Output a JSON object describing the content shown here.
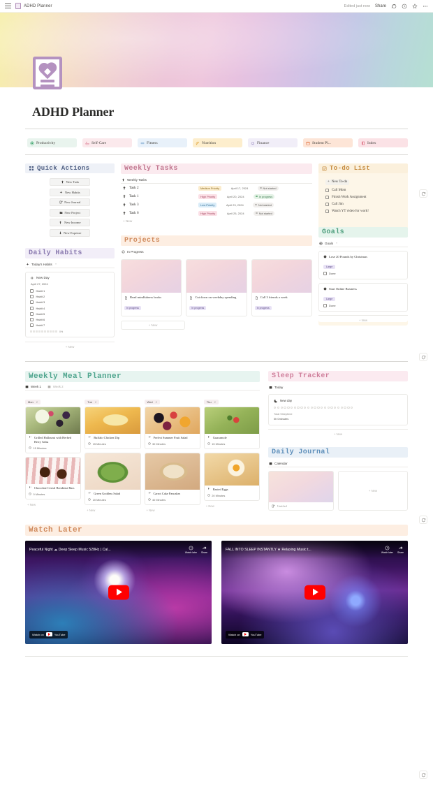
{
  "topbar": {
    "breadcrumb_title": "ADHD Planner",
    "edited_label": "Edited just now",
    "share_label": "Share",
    "icons": [
      "menu-icon",
      "comment-icon",
      "clock-icon",
      "star-icon",
      "more-icon"
    ]
  },
  "page": {
    "title": "ADHD Planner",
    "icon": "heart-document-icon"
  },
  "nav": {
    "items": [
      {
        "label": "Productivity",
        "icon": "target-icon",
        "bg": "#e9f4ee",
        "icon_color": "#3fa56f"
      },
      {
        "label": "Self-Care",
        "icon": "bath-icon",
        "bg": "#fbe9ec",
        "icon_color": "#d9748c"
      },
      {
        "label": "Fitness",
        "icon": "dumbbell-icon",
        "bg": "#e8f1fa",
        "icon_color": "#5e92c4"
      },
      {
        "label": "Nutrition",
        "icon": "carrot-icon",
        "bg": "#fdeecd",
        "icon_color": "#e0a238"
      },
      {
        "label": "Finance",
        "icon": "piggybank-icon",
        "bg": "#f1eef8",
        "icon_color": "#8878b7"
      },
      {
        "label": "Student Pl...",
        "icon": "calendar-icon",
        "bg": "#fde5d7",
        "icon_color": "#e0713f"
      },
      {
        "label": "Index",
        "icon": "book-icon",
        "bg": "#fbe2e6",
        "icon_color": "#d8566d"
      }
    ]
  },
  "quick_actions": {
    "title": "Quick Actions",
    "title_icon": "grid-icon",
    "buttons": [
      {
        "label": "New Task",
        "icon": "pin-icon"
      },
      {
        "label": "New Habits",
        "icon": "sparkle-icon"
      },
      {
        "label": "New Journal",
        "icon": "pencil-square-icon"
      },
      {
        "label": "New Project",
        "icon": "folder-icon"
      },
      {
        "label": "New Income",
        "icon": "arrow-up-icon"
      },
      {
        "label": "New Expense",
        "icon": "arrow-down-icon"
      }
    ]
  },
  "weekly_tasks": {
    "title": "Weekly Tasks",
    "db_tab": "Weekly Tasks",
    "db_tab_icon": "pin-icon",
    "new_label": "+  New",
    "rows": [
      {
        "name": "Task 2",
        "priority": "Medium Priority",
        "priority_bg": "#fbeccd",
        "priority_fg": "#8a6a20",
        "date": "April 17, 2024",
        "status": "Not started",
        "status_bg": "#f1efed",
        "status_fg": "#5c5a56",
        "status_dot": "#b6b4b0"
      },
      {
        "name": "Task 1",
        "priority": "High Priority",
        "priority_bg": "#fbe0e6",
        "priority_fg": "#a3445f",
        "date": "April 20, 2024",
        "status": "In progress",
        "status_bg": "#e4f2e6",
        "status_fg": "#3e7c52",
        "status_dot": "#6aae7c"
      },
      {
        "name": "Task 3",
        "priority": "Low Priority",
        "priority_bg": "#d9ecf8",
        "priority_fg": "#2f6d94",
        "date": "April 23, 2024",
        "status": "Not started",
        "status_bg": "#f1efed",
        "status_fg": "#5c5a56",
        "status_dot": "#b6b4b0"
      },
      {
        "name": "Task 6",
        "priority": "High Priority",
        "priority_bg": "#fbe0e6",
        "priority_fg": "#a3445f",
        "date": "April 25, 2024",
        "status": "Not started",
        "status_bg": "#f1efed",
        "status_fg": "#5c5a56",
        "status_dot": "#b6b4b0"
      }
    ]
  },
  "todo_list": {
    "title": "To-do List",
    "title_icon": "checkbox-icon",
    "new_label": "New To-do",
    "items": [
      "Call Mom",
      "Finish Work Assignment",
      "Call Jim",
      "Watch YT video for work!"
    ]
  },
  "daily_habits": {
    "title": "Daily Habits",
    "db_tab": "Today's Habits",
    "db_tab_icon": "sparkle-icon",
    "card_title": "New Day",
    "card_icon": "gear-icon",
    "date": "April 27, 2024",
    "habits": [
      "Habit 1",
      "Habit 2",
      "Habit 3",
      "Habit 4",
      "Habit 5",
      "Habit 6",
      "Habit 7"
    ],
    "progress_label": "0%",
    "new_label": "+  New"
  },
  "projects": {
    "title": "Projects",
    "db_tab": "In Progress",
    "db_tab_icon": "circle-icon",
    "new_label": "+  New",
    "cards": [
      {
        "name": "Read mindfulness books",
        "tag": "In progress",
        "icon": "file-icon"
      },
      {
        "name": "Cut down on weekday spending",
        "tag": "In progress",
        "icon": "file-icon"
      },
      {
        "name": "Call 3 friends a week",
        "tag": "In progress",
        "icon": "file-icon"
      }
    ]
  },
  "goals": {
    "title": "Goals",
    "db_tab": "Goals",
    "db_tab_icon": "target-icon",
    "new_label": "+  New",
    "done_label": "Done",
    "items": [
      {
        "name": "Lose 20 Pounds by Christmas",
        "size": "Large",
        "icon": "target-icon"
      },
      {
        "name": "Start Online Business",
        "size": "Large",
        "icon": "target-icon"
      }
    ]
  },
  "meal_planner": {
    "title": "Weekly Meal Planner",
    "tabs": [
      {
        "label": "Week 1",
        "active": true,
        "icon": "calendar-icon"
      },
      {
        "label": "Week 2",
        "active": false,
        "icon": "calendar-icon"
      }
    ],
    "new_label": "+  New",
    "columns": [
      {
        "day": "Mon",
        "count": "2",
        "meals": [
          {
            "name": "Grilled Halloumi with Herbed Berry Salsa",
            "time": "15 Minutes"
          },
          {
            "name": "Chocolate Cereal Breakfast Bars",
            "time": "0 Minutes"
          }
        ]
      },
      {
        "day": "Tue",
        "count": "2",
        "meals": [
          {
            "name": "Buffalo Chicken Dip",
            "time": "15 Minutes"
          },
          {
            "name": "Green Goddess Salad",
            "time": "20 Minutes"
          }
        ]
      },
      {
        "day": "Wed",
        "count": "2",
        "meals": [
          {
            "name": "Perfect Summer Fruit Salad",
            "time": "30 Minutes"
          },
          {
            "name": "Carrot Cake Pancakes",
            "time": "40 Minutes"
          }
        ]
      },
      {
        "day": "Thu",
        "count": "2",
        "meals": [
          {
            "name": "Guacamole",
            "time": "15 Minutes"
          },
          {
            "name": "Basted Eggs",
            "time": "20 Minutes"
          }
        ]
      }
    ]
  },
  "sleep_tracker": {
    "title": "Sleep Tracker",
    "db_tab": "Today",
    "db_tab_icon": "calendar-icon",
    "card_title": "New day",
    "card_icon": "moon-icon",
    "total_label": "Total Sleeptime",
    "total_value": "0h 0minutes",
    "new_label": "+  New",
    "dot_count": 24
  },
  "daily_journal": {
    "title": "Daily Journal",
    "db_tab": "Calendar",
    "db_tab_icon": "calendar-icon",
    "entry_title": "Untitled",
    "entry_icon": "pencil-square-icon",
    "new_label": "+  New"
  },
  "watch_later": {
    "title": "Watch Later",
    "videos": [
      {
        "title": "Peaceful Night ☁ Deep Sleep Music 528Hz | Cal...",
        "watch_later_label": "Watch later",
        "share_label": "Share",
        "watch_on_label": "Watch on",
        "brand": "YouTube"
      },
      {
        "title": "FALL INTO SLEEP INSTANTLY ★ Relaxing Music t...",
        "watch_later_label": "Watch later",
        "share_label": "Share",
        "watch_on_label": "Watch on",
        "brand": "YouTube"
      }
    ]
  },
  "floating_buttons": [
    {
      "icon": "refresh-icon"
    },
    {
      "icon": "refresh-icon"
    },
    {
      "icon": "refresh-icon"
    },
    {
      "icon": "refresh-icon"
    }
  ]
}
